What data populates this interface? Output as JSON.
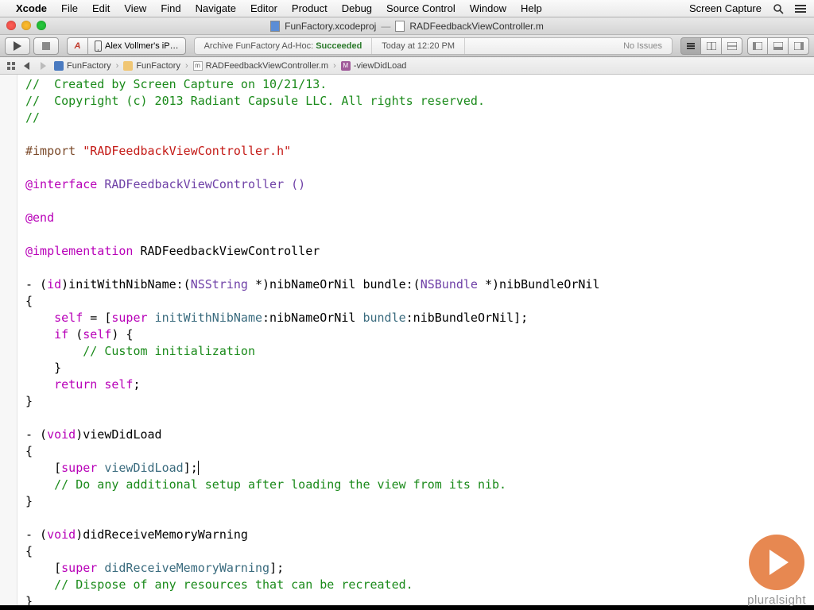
{
  "menubar": {
    "app": "Xcode",
    "items": [
      "File",
      "Edit",
      "View",
      "Find",
      "Navigate",
      "Editor",
      "Product",
      "Debug",
      "Source Control",
      "Window",
      "Help"
    ],
    "right": [
      "Screen Capture"
    ]
  },
  "window": {
    "proj_title": "FunFactory.xcodeproj",
    "file_title": "RADFeedbackViewController.m"
  },
  "toolbar": {
    "scheme_app_letter": "A",
    "scheme_target": "Alex Vollmer's iP…",
    "status_prefix": "Archive FunFactory Ad-Hoc:",
    "status_result": "Succeeded",
    "status_time": "Today at 12:20 PM",
    "issues": "No Issues"
  },
  "jumpbar": {
    "items": [
      "FunFactory",
      "FunFactory",
      "RADFeedbackViewController.m",
      "-viewDidLoad"
    ]
  },
  "code": {
    "l1": "//  Created by Screen Capture on 10/21/13.",
    "l2": "//  Copyright (c) 2013 Radiant Capsule LLC. All rights reserved.",
    "l3": "//",
    "import_pre": "#import ",
    "import_str": "\"RADFeedbackViewController.h\"",
    "interface_kw": "@interface",
    "interface_rest": " RADFeedbackViewController ()",
    "end_kw": "@end",
    "impl_kw": "@implementation",
    "impl_rest": " RADFeedbackViewController",
    "m1_a": "- (",
    "m1_id": "id",
    "m1_b": ")initWithNibName:(",
    "m1_t1": "NSString",
    "m1_c": " *)nibNameOrNil bundle:(",
    "m1_t2": "NSBundle",
    "m1_d": " *)nibBundleOrNil",
    "brace_o": "{",
    "b1_a": "    ",
    "b1_self": "self",
    "b1_b": " = [",
    "b1_super": "super",
    "b1_c": " ",
    "b1_fn": "initWithNibName",
    "b1_d": ":nibNameOrNil ",
    "b1_fn2": "bundle",
    "b1_e": ":nibBundleOrNil];",
    "b2_a": "    ",
    "b2_if": "if",
    "b2_b": " (",
    "b2_self": "self",
    "b2_c": ") {",
    "b3": "        // Custom initialization",
    "b4": "    }",
    "b5_a": "    ",
    "b5_ret": "return",
    "b5_b": " ",
    "b5_self": "self",
    "b5_c": ";",
    "brace_c": "}",
    "m2_a": "- (",
    "m2_void": "void",
    "m2_b": ")viewDidLoad",
    "b6_a": "    [",
    "b6_super": "super",
    "b6_b": " ",
    "b6_fn": "viewDidLoad",
    "b6_c": "];",
    "b7": "    // Do any additional setup after loading the view from its nib.",
    "m3_a": "- (",
    "m3_void": "void",
    "m3_b": ")didReceiveMemoryWarning",
    "b8_a": "    [",
    "b8_super": "super",
    "b8_b": " ",
    "b8_fn": "didReceiveMemoryWarning",
    "b8_c": "];",
    "b9": "    // Dispose of any resources that can be recreated."
  },
  "watermark": "pluralsight"
}
